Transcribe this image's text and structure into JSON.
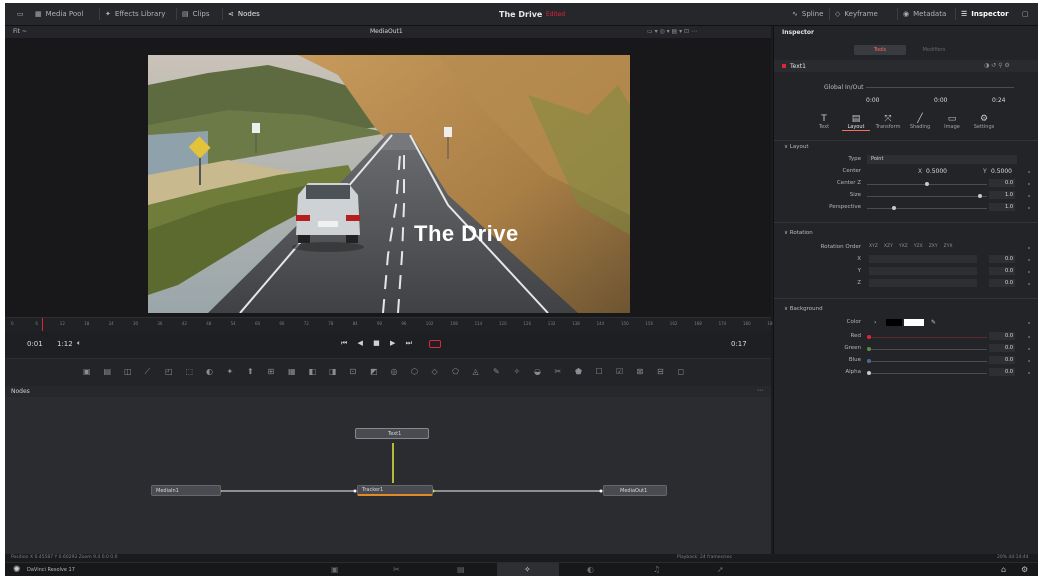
{
  "topbar": {
    "items": [
      "Media Pool",
      "Effects Library",
      "Clips",
      "Nodes"
    ],
    "title": "The Drive",
    "title_badge": "Edited",
    "right_items": [
      "Spline",
      "Keyframe",
      "Metadata",
      "Inspector"
    ]
  },
  "viewer": {
    "left_controls": "Fit  ~",
    "name": "MediaOut1",
    "overlay_text": "The Drive",
    "timecode_left": "0:01",
    "timecode_mid": "1:12",
    "timecode_right": "0:17"
  },
  "ruler": {
    "labels": [
      "0",
      "6",
      "12",
      "18",
      "24",
      "30",
      "36",
      "42",
      "48",
      "54",
      "60",
      "66",
      "72",
      "78",
      "84",
      "90",
      "96",
      "102",
      "108",
      "114",
      "120",
      "126",
      "132",
      "138",
      "144",
      "150",
      "156",
      "162",
      "168",
      "174",
      "180",
      "186"
    ]
  },
  "nodes": {
    "panel_title": "Nodes",
    "items": {
      "text": "Text1",
      "medialn": "MediaIn1",
      "tracker": "Tracker1",
      "mediaout": "MediaOut1"
    }
  },
  "status": {
    "left": "Position  X  0.45587   Y  0.60293   Zoom  9.4     0.0     0.0",
    "mid": "Playback: 24 frames/sec",
    "right": "20%  44:14:44"
  },
  "bottombar": {
    "app_name": "DaVinci Resolve 17"
  },
  "inspector": {
    "title": "Inspector",
    "tabs": [
      "Tools",
      "Modifiers"
    ],
    "node_name": "Text1",
    "global_in_out": "Global In/Out",
    "global_values": [
      "0:00",
      "0:00",
      "0:24"
    ],
    "tool_tabs": [
      "Text",
      "Layout",
      "Transform",
      "Shading",
      "Image",
      "Settings"
    ],
    "layout": {
      "section": "Layout",
      "type_label": "Type",
      "type_value": "Point",
      "center_label": "Center",
      "center_x_label": "X",
      "center_x": "0.5000",
      "center_y_label": "Y",
      "center_y": "0.5000",
      "center_z_label": "Center Z",
      "center_z": "0.0",
      "size_label": "Size",
      "size": "1.0",
      "perspective_label": "Perspective",
      "perspective": "1.0"
    },
    "rotation": {
      "section": "Rotation",
      "order_label": "Rotation Order",
      "order_values": [
        "XYZ",
        "XZY",
        "YXZ",
        "YZX",
        "ZXY",
        "ZYX"
      ],
      "x_label": "X",
      "x": "0.0",
      "y_label": "Y",
      "y": "0.0",
      "z_label": "Z",
      "z": "0.0"
    },
    "background": {
      "section": "Background",
      "color_label": "Color",
      "red_label": "Red",
      "red": "0.0",
      "green_label": "Green",
      "green": "0.0",
      "blue_label": "Blue",
      "blue": "0.0",
      "alpha_label": "Alpha",
      "alpha": "0.0"
    }
  },
  "colors": {
    "accent_red": "#e0243a",
    "node_link": "#f2f2f2",
    "node_link_active": "#e6e640",
    "selected_tab": "#ff6a5c"
  }
}
